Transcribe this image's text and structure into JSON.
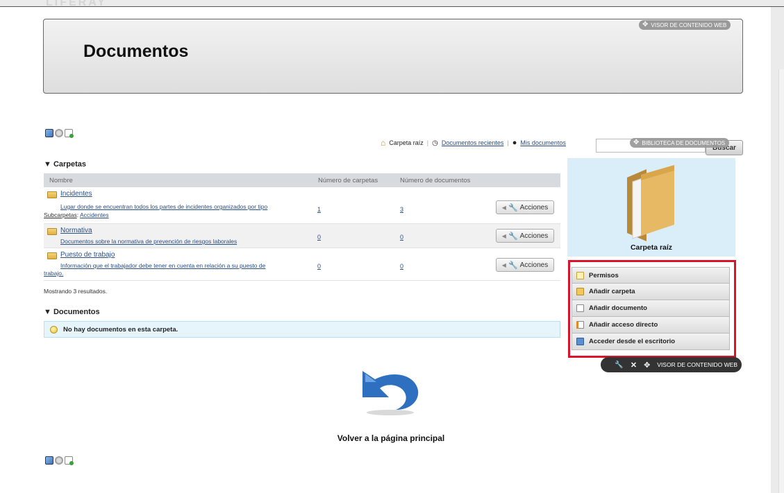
{
  "ghost_logo": "LIFERAY",
  "header": {
    "title": "Documentos",
    "portlet_label": "VISOR DE CONTENIDO WEB"
  },
  "library": {
    "portlet_label": "BIBLIOTECA DE DOCUMENTOS"
  },
  "nav": {
    "root_label": "Carpeta raíz",
    "recent_label": "Documentos recientes",
    "mine_label": "Mis documentos"
  },
  "search": {
    "button_label": "Buscar",
    "value": ""
  },
  "folders_section": {
    "title": "Carpetas",
    "columns": [
      "Nombre",
      "Número de carpetas",
      "Número de documentos"
    ],
    "rows": [
      {
        "name": "Incidentes",
        "description": "Lugar donde se encuentran todos los partes de incidentes organizados por tipo",
        "subfolders_label": "Subcarpetas",
        "subfolders_sep": ":",
        "subfolders_value": "Accidentes",
        "folders": "1",
        "documents": "3",
        "actions_label": "Acciones"
      },
      {
        "name": "Normativa",
        "description": "Documentos sobre la normativa de prevención de riesgos laborales",
        "folders": "0",
        "documents": "0",
        "actions_label": "Acciones"
      },
      {
        "name": "Puesto de trabajo",
        "description_line1": "Información que el trabajador debe tener en cuenta en relación a su puesto de",
        "description_line2": "trabajo.",
        "folders": "0",
        "documents": "0",
        "actions_label": "Acciones"
      }
    ],
    "showing": "Mostrando 3 resultados."
  },
  "documents_section": {
    "title": "Documentos",
    "empty_message": "No hay documentos en esta carpeta."
  },
  "preview": {
    "label": "Carpeta raíz",
    "menu": [
      "Permisos",
      "Añadir carpeta",
      "Añadir documento",
      "Añadir acceso directo",
      "Acceder desde el escritorio"
    ]
  },
  "bottom_portlet": {
    "label": "VISOR DE CONTENIDO WEB"
  },
  "back": {
    "label": "Volver a la página principal"
  },
  "colors": {
    "accent_red": "#d8132a",
    "link": "#2b4f83",
    "info_bg": "#e6f4fc",
    "preview_bg": "#daeefa"
  }
}
